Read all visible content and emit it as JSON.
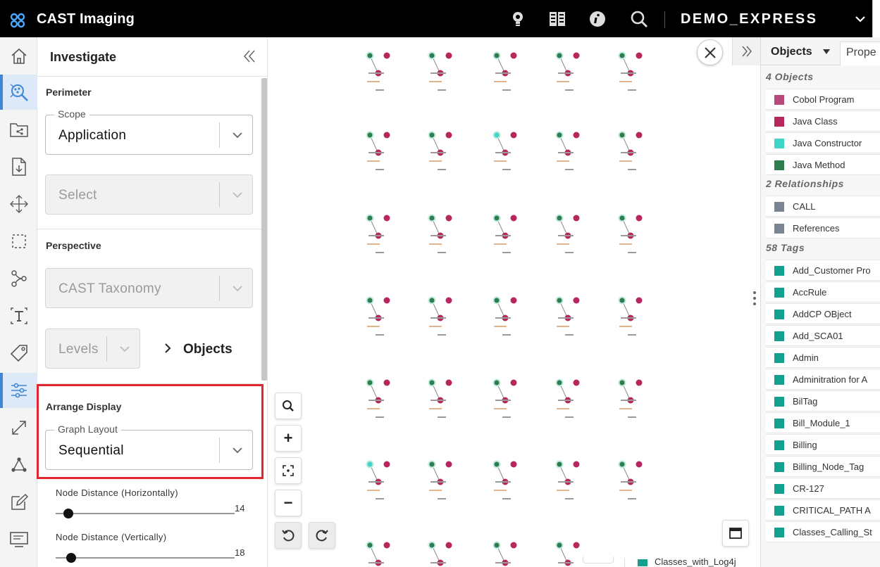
{
  "topbar": {
    "app_title": "CAST Imaging",
    "application_name": "DEMO_EXPRESS",
    "icons": [
      "bulb-icon",
      "report-icon",
      "info-icon",
      "search-icon",
      "chevron-down-icon"
    ]
  },
  "rail": {
    "items": [
      "home-icon",
      "investigate-icon",
      "folder-share-icon",
      "file-download-icon",
      "move-icon",
      "select-area-icon",
      "path-icon",
      "text-icon",
      "tag-icon",
      "settings-sliders-icon",
      "expand-icon",
      "graph-icon",
      "edit-icon",
      "screen-icon"
    ],
    "active": "settings-sliders-icon"
  },
  "panel": {
    "title": "Investigate",
    "perimeter": {
      "section": "Perimeter",
      "scope_label": "Scope",
      "scope_value": "Application",
      "select_placeholder": "Select"
    },
    "perspective": {
      "section": "Perspective",
      "taxonomy_value": "CAST Taxonomy",
      "levels_value": "Levels",
      "objects_link": "Objects"
    },
    "arrange": {
      "section": "Arrange Display",
      "layout_label": "Graph Layout",
      "layout_value": "Sequential",
      "node_distance_h_label": "Node Distance (Horizontally)",
      "node_distance_h_value": "14",
      "node_distance_h_fraction": 0.07,
      "node_distance_v_label": "Node Distance (Vertically)",
      "node_distance_v_value": "18",
      "node_distance_v_fraction": 0.09
    }
  },
  "canvas": {
    "controls": [
      "search-icon",
      "zoom-in-icon",
      "fit-view-icon",
      "zoom-out-icon",
      "undo-icon",
      "redo-icon"
    ],
    "plus_label": "+",
    "minus_label": "−",
    "node_colors": {
      "java_method": "#2e7d4f",
      "java_class": "#b8265e",
      "java_constructor": "#3fd6c8"
    },
    "constructor_node_positions": [
      "row2-col3",
      "row6-col1"
    ]
  },
  "legend": {
    "tab_objects": "Objects",
    "tab_properties": "Prope",
    "objects_header": "4 Objects",
    "objects": [
      {
        "label": "Cobol Program",
        "color": "#b64a7c"
      },
      {
        "label": "Java Class",
        "color": "#b8265e"
      },
      {
        "label": "Java Constructor",
        "color": "#3fd6c8"
      },
      {
        "label": "Java Method",
        "color": "#2e7d4f"
      }
    ],
    "relationships_header": "2 Relationships",
    "relationships": [
      {
        "label": "CALL",
        "color": "#7a8592"
      },
      {
        "label": "References",
        "color": "#7a8592"
      }
    ],
    "tags_header": "58 Tags",
    "tag_color": "#13a08e",
    "tags": [
      "Add_Customer Pro",
      "AccRule",
      "AddCP OBject",
      "Add_SCA01",
      "Admin",
      "Adminitration for A",
      "BilTag",
      "Bill_Module_1",
      "Billing",
      "Billing_Node_Tag",
      "CR-127",
      "CRITICAL_PATH A",
      "Classes_Calling_St"
    ],
    "tag_peek": "Classes_with_Log4j"
  }
}
